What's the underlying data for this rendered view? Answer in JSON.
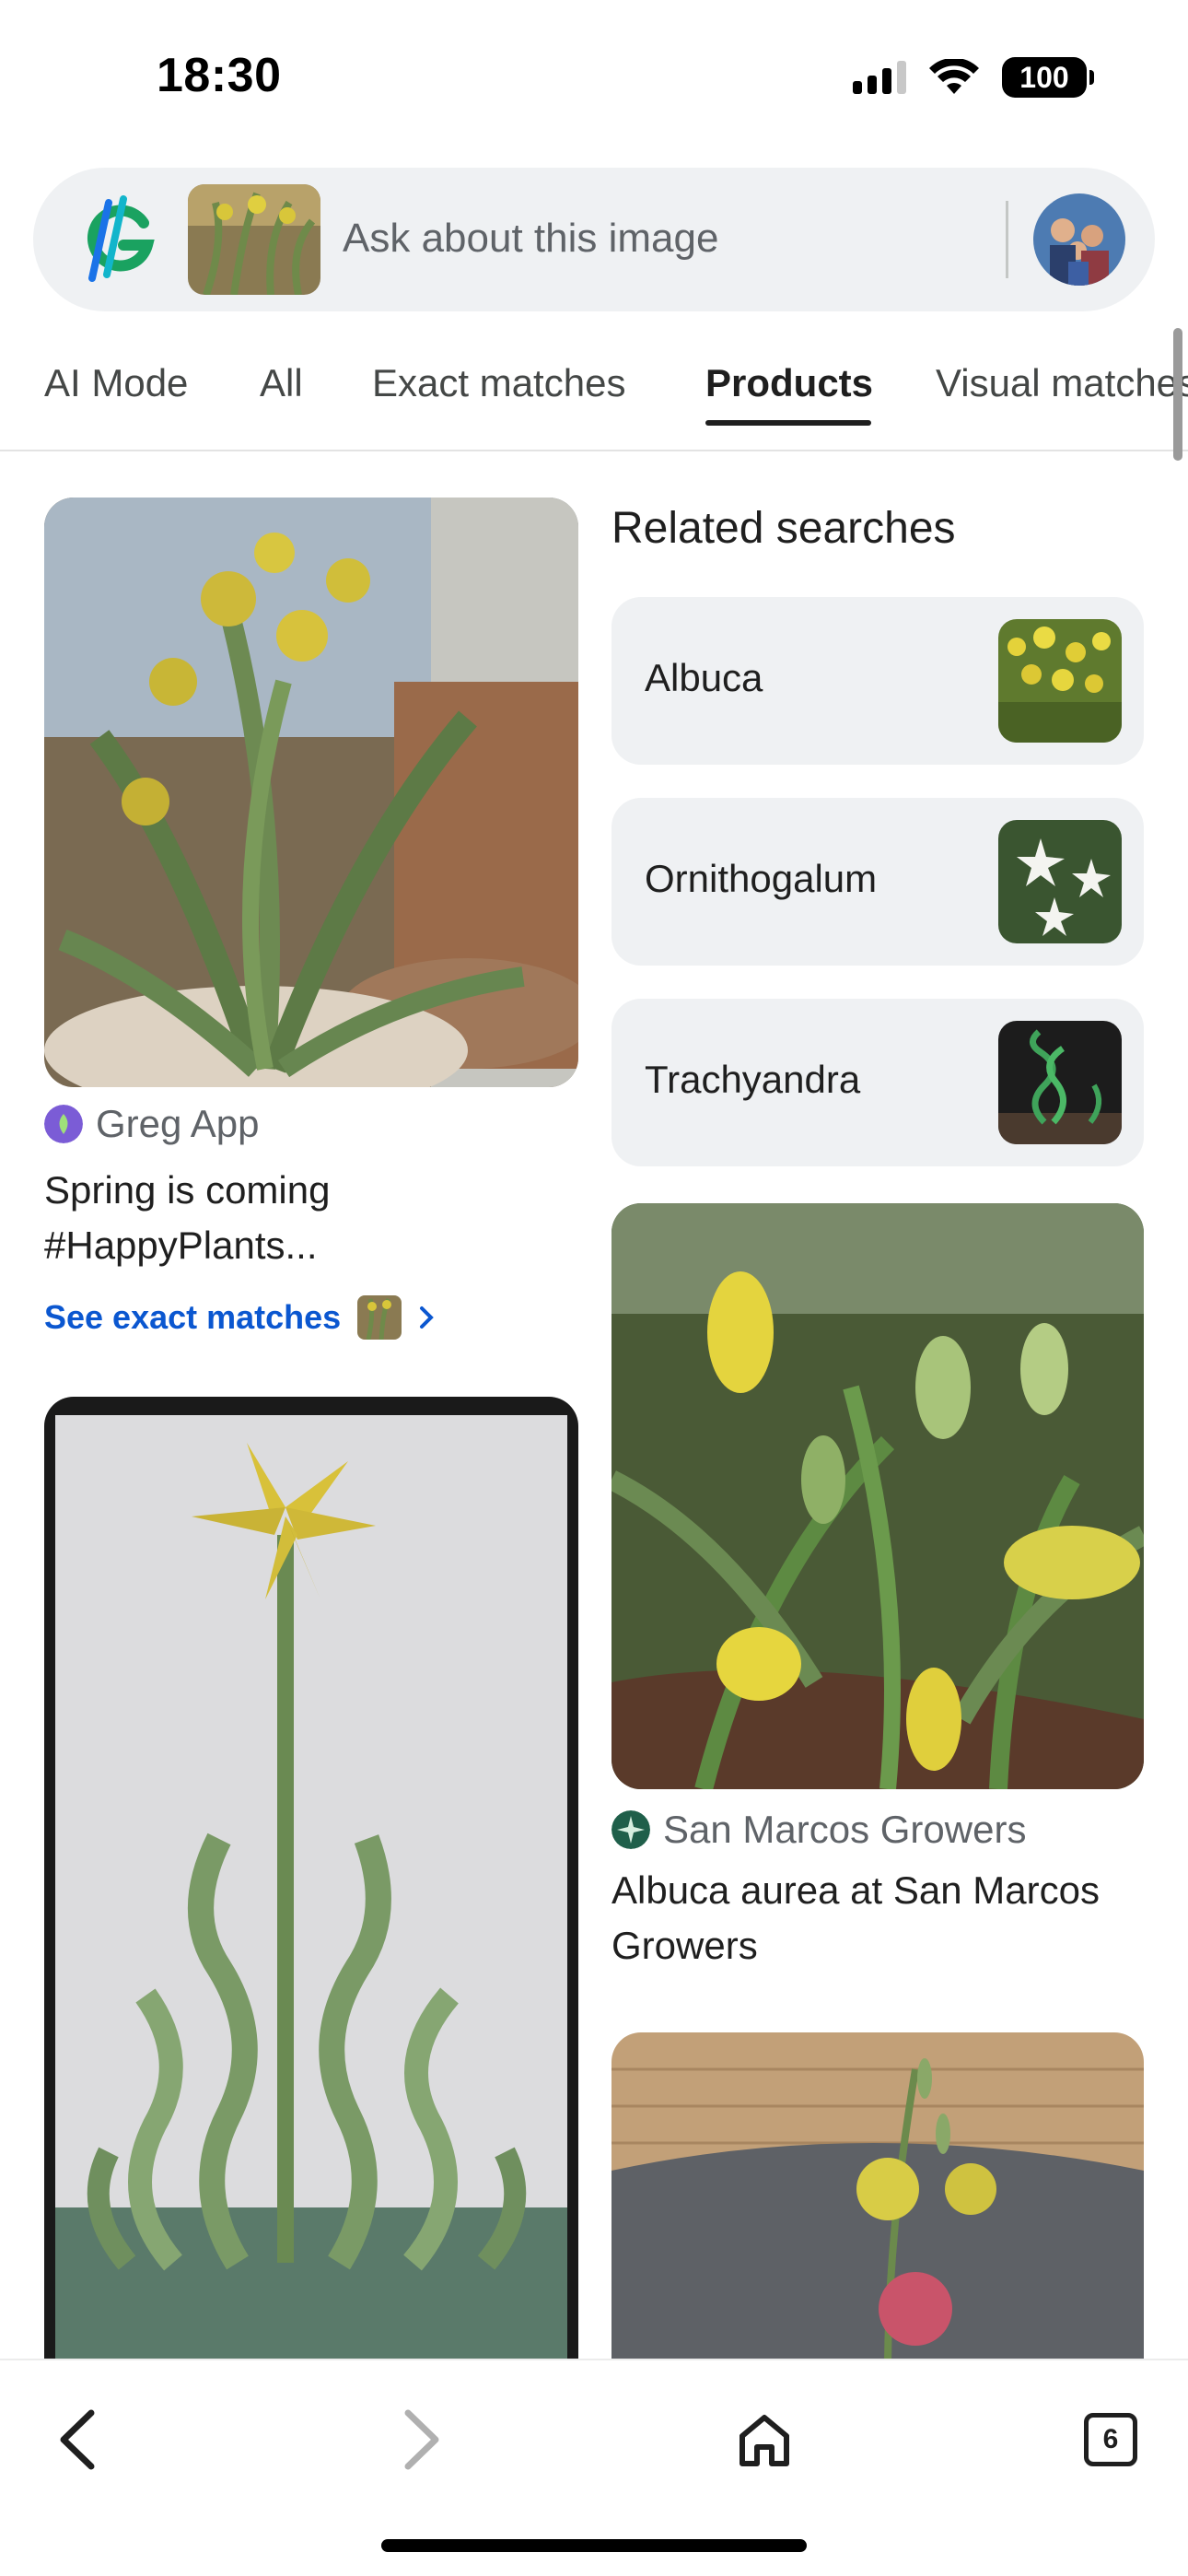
{
  "status": {
    "time": "18:30",
    "battery": "100"
  },
  "search": {
    "placeholder": "Ask about this image"
  },
  "tabs": [
    {
      "label": "AI Mode"
    },
    {
      "label": "All"
    },
    {
      "label": "Exact matches"
    },
    {
      "label": "Products",
      "active": true
    },
    {
      "label": "Visual matches"
    }
  ],
  "results": {
    "left": [
      {
        "source": "Greg App",
        "title": "Spring is coming #HappyPlants...",
        "link": "See exact matches"
      }
    ],
    "right": [
      {
        "source": "San Marcos Growers",
        "title": "Albuca aurea at San Marcos Growers"
      }
    ]
  },
  "related": {
    "heading": "Related searches",
    "items": [
      {
        "label": "Albuca"
      },
      {
        "label": "Ornithogalum"
      },
      {
        "label": "Trachyandra"
      }
    ]
  },
  "nav": {
    "tab_count": "6"
  },
  "colors": {
    "link_blue": "#0b57d0",
    "chip_bg": "#eff1f3",
    "text_dark": "#1f1f1f",
    "text_muted": "#5f6368"
  }
}
